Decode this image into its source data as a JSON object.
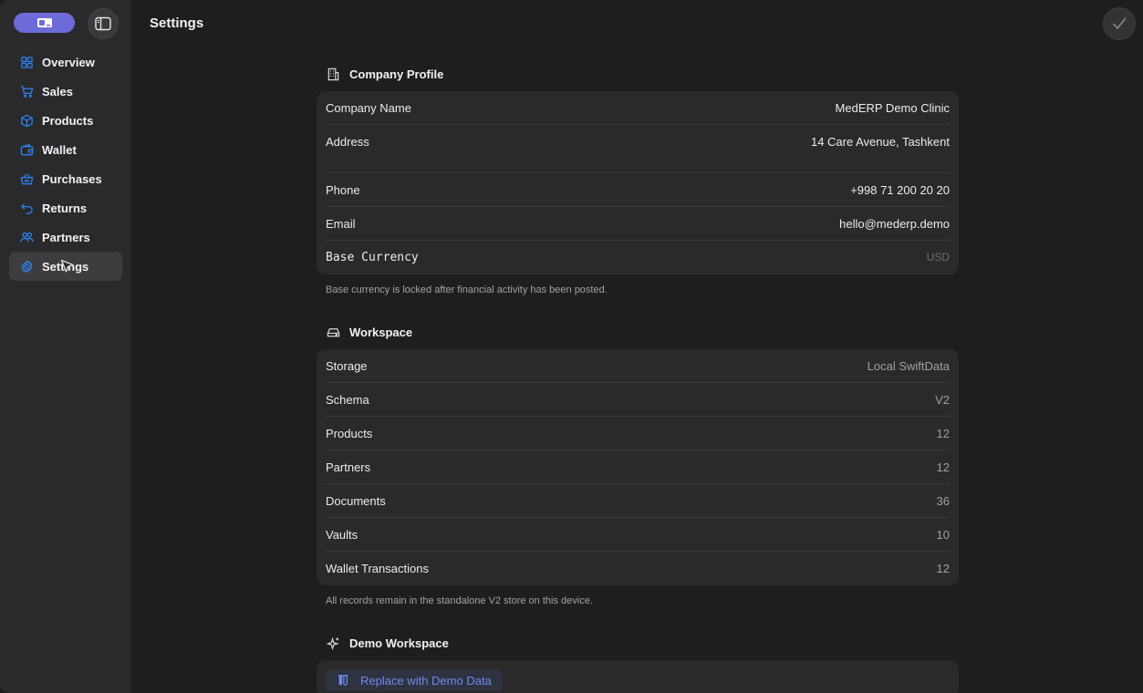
{
  "header": {
    "title": "Settings"
  },
  "sidebar": {
    "items": [
      {
        "label": "Overview",
        "icon": "grid-icon"
      },
      {
        "label": "Sales",
        "icon": "cart-icon"
      },
      {
        "label": "Products",
        "icon": "box-icon"
      },
      {
        "label": "Wallet",
        "icon": "wallet-icon"
      },
      {
        "label": "Purchases",
        "icon": "basket-icon"
      },
      {
        "label": "Returns",
        "icon": "return-arrow-icon"
      },
      {
        "label": "Partners",
        "icon": "people-icon"
      },
      {
        "label": "Settings",
        "icon": "gear-icon",
        "active": true
      }
    ]
  },
  "company_profile": {
    "title": "Company Profile",
    "rows": [
      {
        "label": "Company Name",
        "value": "MedERP Demo Clinic"
      },
      {
        "label": "Address",
        "value": "14 Care Avenue, Tashkent"
      },
      {
        "label": "Phone",
        "value": "+998 71 200 20 20"
      },
      {
        "label": "Email",
        "value": "hello@mederp.demo"
      },
      {
        "label": "Base Currency",
        "value": "USD"
      }
    ],
    "footnote": "Base currency is locked after financial activity has been posted."
  },
  "workspace": {
    "title": "Workspace",
    "rows": [
      {
        "label": "Storage",
        "value": "Local SwiftData"
      },
      {
        "label": "Schema",
        "value": "V2"
      },
      {
        "label": "Products",
        "value": "12"
      },
      {
        "label": "Partners",
        "value": "12"
      },
      {
        "label": "Documents",
        "value": "36"
      },
      {
        "label": "Vaults",
        "value": "10"
      },
      {
        "label": "Wallet Transactions",
        "value": "12"
      }
    ],
    "footnote": "All records remain in the standalone V2 store on this device."
  },
  "demo_workspace": {
    "title": "Demo Workspace",
    "button_label": "Replace with Demo Data"
  },
  "colors": {
    "accent": "#2f80ed",
    "profile_pill": "#6f6ad9",
    "demo_button_text": "#6e8cf0"
  }
}
